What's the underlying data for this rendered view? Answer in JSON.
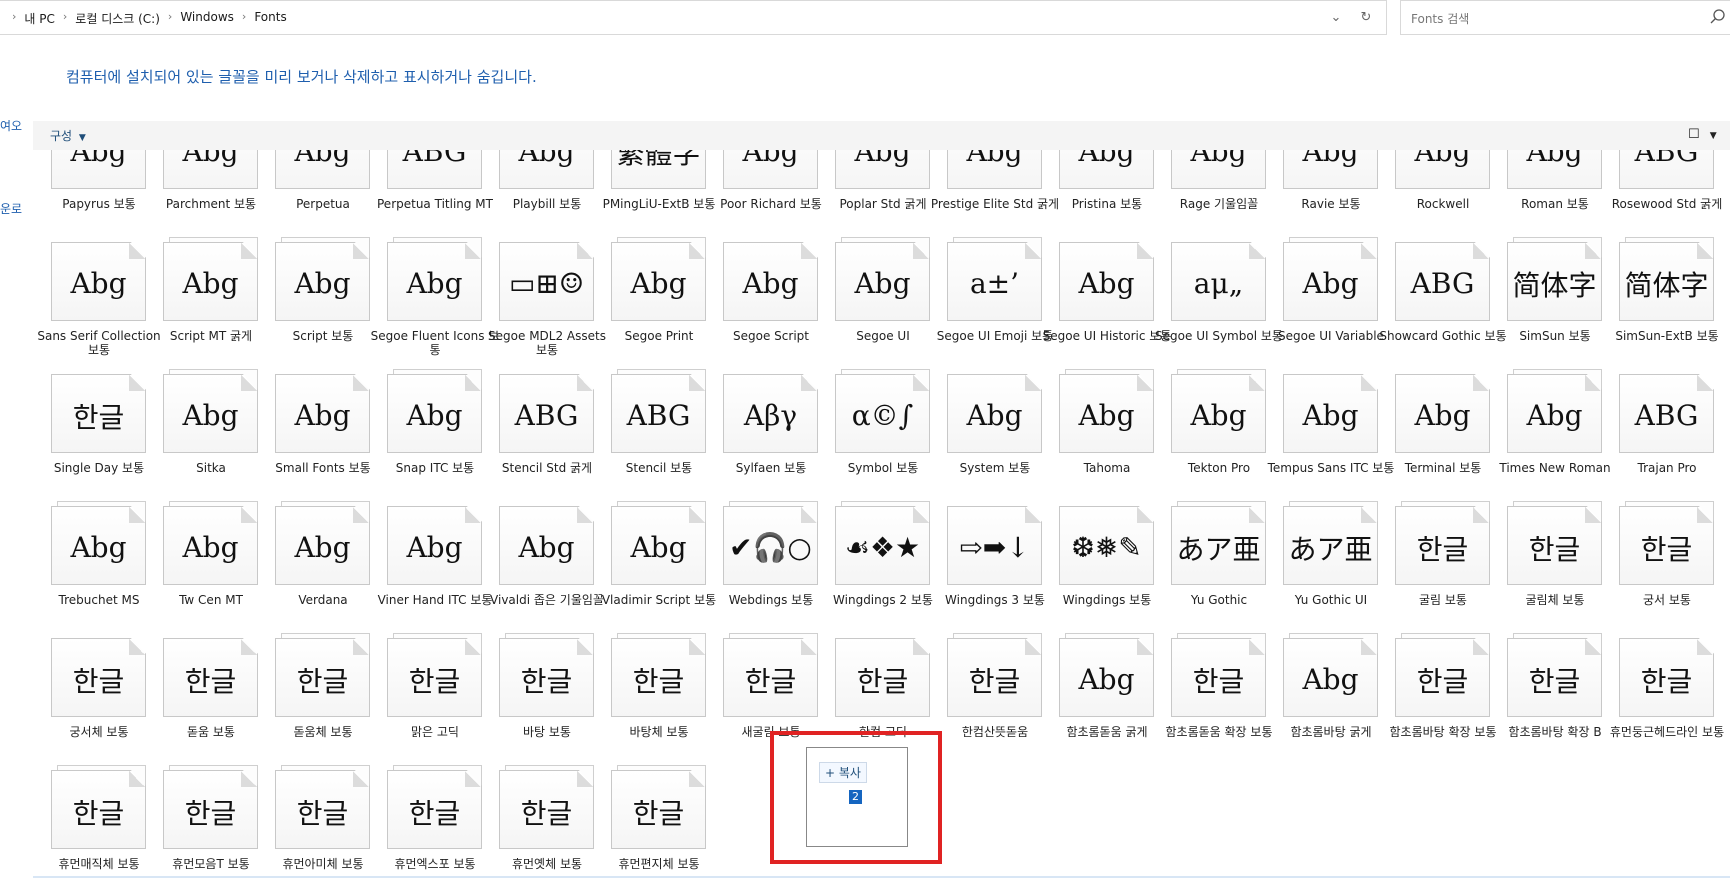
{
  "address": {
    "crumbs": [
      "내 PC",
      "로컬 디스크 (C:)",
      "Windows",
      "Fonts"
    ]
  },
  "search": {
    "placeholder": "Fonts 검색"
  },
  "description": "컴퓨터에 설치되어 있는 글꼴을 미리 보거나 삭제하고 표시하거나 숨깁니다.",
  "left_nav": {
    "item1": "여오",
    "item2": "운로"
  },
  "toolbar": {
    "organize": "구성",
    "help": "?"
  },
  "drag_ghost": {
    "copy_label": "+ 복사",
    "count": "2"
  },
  "fonts": [
    {
      "label": "Papyrus 보통",
      "sample": "Abg"
    },
    {
      "label": "Parchment 보통",
      "sample": "Abg"
    },
    {
      "label": "Perpetua",
      "sample": "Abg"
    },
    {
      "label": "Perpetua Titling MT",
      "sample": "ABG"
    },
    {
      "label": "Playbill 보통",
      "sample": "Abg"
    },
    {
      "label": "PMingLiU-ExtB 보통",
      "sample": "繁體字"
    },
    {
      "label": "Poor Richard 보통",
      "sample": "Abg"
    },
    {
      "label": "Poplar Std 굵게",
      "sample": "Abg"
    },
    {
      "label": "Prestige Elite Std 굵게",
      "sample": "Abg"
    },
    {
      "label": "Pristina 보통",
      "sample": "Abg"
    },
    {
      "label": "Rage 기울임꼴",
      "sample": "Abg"
    },
    {
      "label": "Ravie 보통",
      "sample": "Abg"
    },
    {
      "label": "Rockwell",
      "sample": "Abg"
    },
    {
      "label": "Roman 보통",
      "sample": "Abg"
    },
    {
      "label": "Rosewood Std 굵게",
      "sample": "ABG"
    },
    {
      "label": "Sans Serif Collection 보통",
      "sample": "Abg"
    },
    {
      "label": "Script MT 굵게",
      "sample": "Abg"
    },
    {
      "label": "Script 보통",
      "sample": "Abg"
    },
    {
      "label": "Segoe Fluent Icons 보통",
      "sample": "Abg"
    },
    {
      "label": "Segoe MDL2 Assets 보통",
      "sample": "▭⊞☺"
    },
    {
      "label": "Segoe Print",
      "sample": "Abg"
    },
    {
      "label": "Segoe Script",
      "sample": "Abg"
    },
    {
      "label": "Segoe UI",
      "sample": "Abg"
    },
    {
      "label": "Segoe UI Emoji 보통",
      "sample": "a±’"
    },
    {
      "label": "Segoe UI Historic 보통",
      "sample": "Abg"
    },
    {
      "label": "Segoe UI Symbol 보통",
      "sample": "aμ„"
    },
    {
      "label": "Segoe UI Variable",
      "sample": "Abg"
    },
    {
      "label": "Showcard Gothic 보통",
      "sample": "ABG"
    },
    {
      "label": "SimSun 보통",
      "sample": "简体字"
    },
    {
      "label": "SimSun-ExtB 보통",
      "sample": "简体字"
    },
    {
      "label": "Single Day 보통",
      "sample": "한글"
    },
    {
      "label": "Sitka",
      "sample": "Abg"
    },
    {
      "label": "Small Fonts 보통",
      "sample": "Abg"
    },
    {
      "label": "Snap ITC 보통",
      "sample": "Abg"
    },
    {
      "label": "Stencil Std 굵게",
      "sample": "ABG"
    },
    {
      "label": "Stencil 보통",
      "sample": "ABG"
    },
    {
      "label": "Sylfaen 보통",
      "sample": "Αβγ"
    },
    {
      "label": "Symbol 보통",
      "sample": "α©∫"
    },
    {
      "label": "System 보통",
      "sample": "Abg"
    },
    {
      "label": "Tahoma",
      "sample": "Abg"
    },
    {
      "label": "Tekton Pro",
      "sample": "Abg"
    },
    {
      "label": "Tempus Sans ITC 보통",
      "sample": "Abg"
    },
    {
      "label": "Terminal 보통",
      "sample": "Abg"
    },
    {
      "label": "Times New Roman",
      "sample": "Abg"
    },
    {
      "label": "Trajan Pro",
      "sample": "ABG"
    },
    {
      "label": "Trebuchet MS",
      "sample": "Abg"
    },
    {
      "label": "Tw Cen MT",
      "sample": "Abg"
    },
    {
      "label": "Verdana",
      "sample": "Abg"
    },
    {
      "label": "Viner Hand ITC 보통",
      "sample": "Abg"
    },
    {
      "label": "Vivaldi 좁은 기울임꼴",
      "sample": "Abg"
    },
    {
      "label": "Vladimir Script 보통",
      "sample": "Abg"
    },
    {
      "label": "Webdings 보통",
      "sample": "✔🎧○"
    },
    {
      "label": "Wingdings 2 보통",
      "sample": "☙❖★"
    },
    {
      "label": "Wingdings 3 보통",
      "sample": "⇨➡↓"
    },
    {
      "label": "Wingdings 보통",
      "sample": "❆❅✎"
    },
    {
      "label": "Yu Gothic",
      "sample": "あア亜"
    },
    {
      "label": "Yu Gothic UI",
      "sample": "あア亜"
    },
    {
      "label": "굴림 보통",
      "sample": "한글"
    },
    {
      "label": "굴림체 보통",
      "sample": "한글"
    },
    {
      "label": "궁서 보통",
      "sample": "한글"
    },
    {
      "label": "궁서체 보통",
      "sample": "한글"
    },
    {
      "label": "돋움 보통",
      "sample": "한글"
    },
    {
      "label": "돋움체 보통",
      "sample": "한글"
    },
    {
      "label": "맑은 고딕",
      "sample": "한글"
    },
    {
      "label": "바탕 보통",
      "sample": "한글"
    },
    {
      "label": "바탕체 보통",
      "sample": "한글"
    },
    {
      "label": "새굴림 보통",
      "sample": "한글"
    },
    {
      "label": "한컴 고딕",
      "sample": "한글"
    },
    {
      "label": "한컴산뜻돋움",
      "sample": "한글"
    },
    {
      "label": "함초롬돋움 굵게",
      "sample": "Abg"
    },
    {
      "label": "함초롬돋움 확장 보통",
      "sample": "한글"
    },
    {
      "label": "함초롬바탕 굵게",
      "sample": "Abg"
    },
    {
      "label": "함초롬바탕 확장 보통",
      "sample": "한글"
    },
    {
      "label": "함초롬바탕 확장 B",
      "sample": "한글"
    },
    {
      "label": "휴먼둥근헤드라인 보통",
      "sample": "한글"
    },
    {
      "label": "휴먼매직체 보통",
      "sample": "한글"
    },
    {
      "label": "휴먼모음T 보통",
      "sample": "한글"
    },
    {
      "label": "휴먼아미체 보통",
      "sample": "한글"
    },
    {
      "label": "휴먼엑스포 보통",
      "sample": "한글"
    },
    {
      "label": "휴먼옛체 보통",
      "sample": "한글"
    },
    {
      "label": "휴먼편지체 보통",
      "sample": "한글"
    }
  ]
}
